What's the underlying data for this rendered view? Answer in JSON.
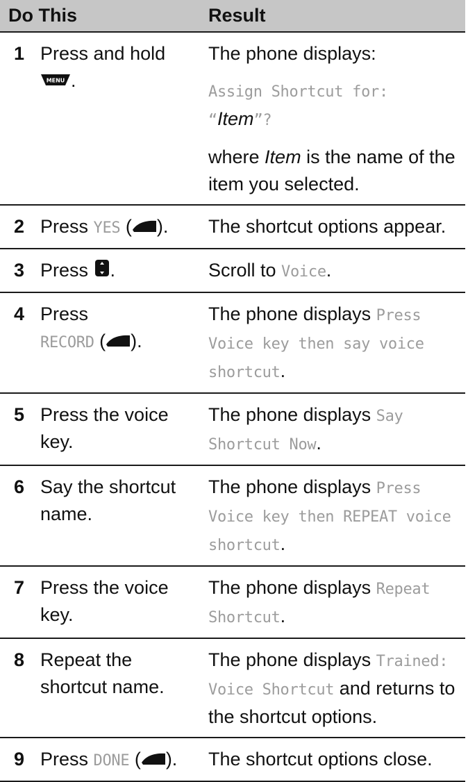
{
  "header": {
    "do_this": "Do This",
    "result": "Result"
  },
  "icons": {
    "menu_key": "MENU",
    "left_soft_key": "left-soft-key-icon",
    "right_soft_key": "right-soft-key-icon",
    "nav_key": "nav-key-icon"
  },
  "rows": [
    {
      "num": "1",
      "do": {
        "pre": "Press and hold",
        "post": "."
      },
      "result": {
        "line1": "The phone displays:",
        "line2a": "Assign Shortcut for:",
        "q_open": "“",
        "item": "Item",
        "q_close": "”?",
        "line3a": "where ",
        "line3_item": "Item",
        "line3b": " is the name of the item you selected."
      }
    },
    {
      "num": "2",
      "do": {
        "pre": "Press ",
        "key": "YES",
        "open": " (",
        "close": ")."
      },
      "result": {
        "text": "The shortcut options appear."
      }
    },
    {
      "num": "3",
      "do": {
        "pre": "Press ",
        "post": "."
      },
      "result": {
        "pre": "Scroll to ",
        "key": "Voice",
        "post": "."
      }
    },
    {
      "num": "4",
      "do": {
        "pre": "Press",
        "key": "RECORD",
        "open": " (",
        "close": ")."
      },
      "result": {
        "pre": "The phone displays ",
        "key": "Press Voice key then say voice shortcut",
        "post": "."
      }
    },
    {
      "num": "5",
      "do": {
        "text": "Press the voice key."
      },
      "result": {
        "pre": "The phone displays ",
        "key": "Say Shortcut Now",
        "post": "."
      }
    },
    {
      "num": "6",
      "do": {
        "text": "Say the shortcut name."
      },
      "result": {
        "pre": "The phone displays ",
        "key": "Press Voice key then REPEAT voice shortcut",
        "post": "."
      }
    },
    {
      "num": "7",
      "do": {
        "text": "Press the voice key."
      },
      "result": {
        "pre": "The phone displays ",
        "key": "Repeat Shortcut",
        "post": "."
      }
    },
    {
      "num": "8",
      "do": {
        "text": "Repeat the shortcut name."
      },
      "result": {
        "pre": "The phone displays ",
        "key": "Trained: Voice Shortcut",
        "post": " and returns to the shortcut options."
      }
    },
    {
      "num": "9",
      "do": {
        "pre": "Press ",
        "key": "DONE",
        "open": " (",
        "close": ")."
      },
      "result": {
        "text": "The shortcut options close."
      }
    }
  ]
}
